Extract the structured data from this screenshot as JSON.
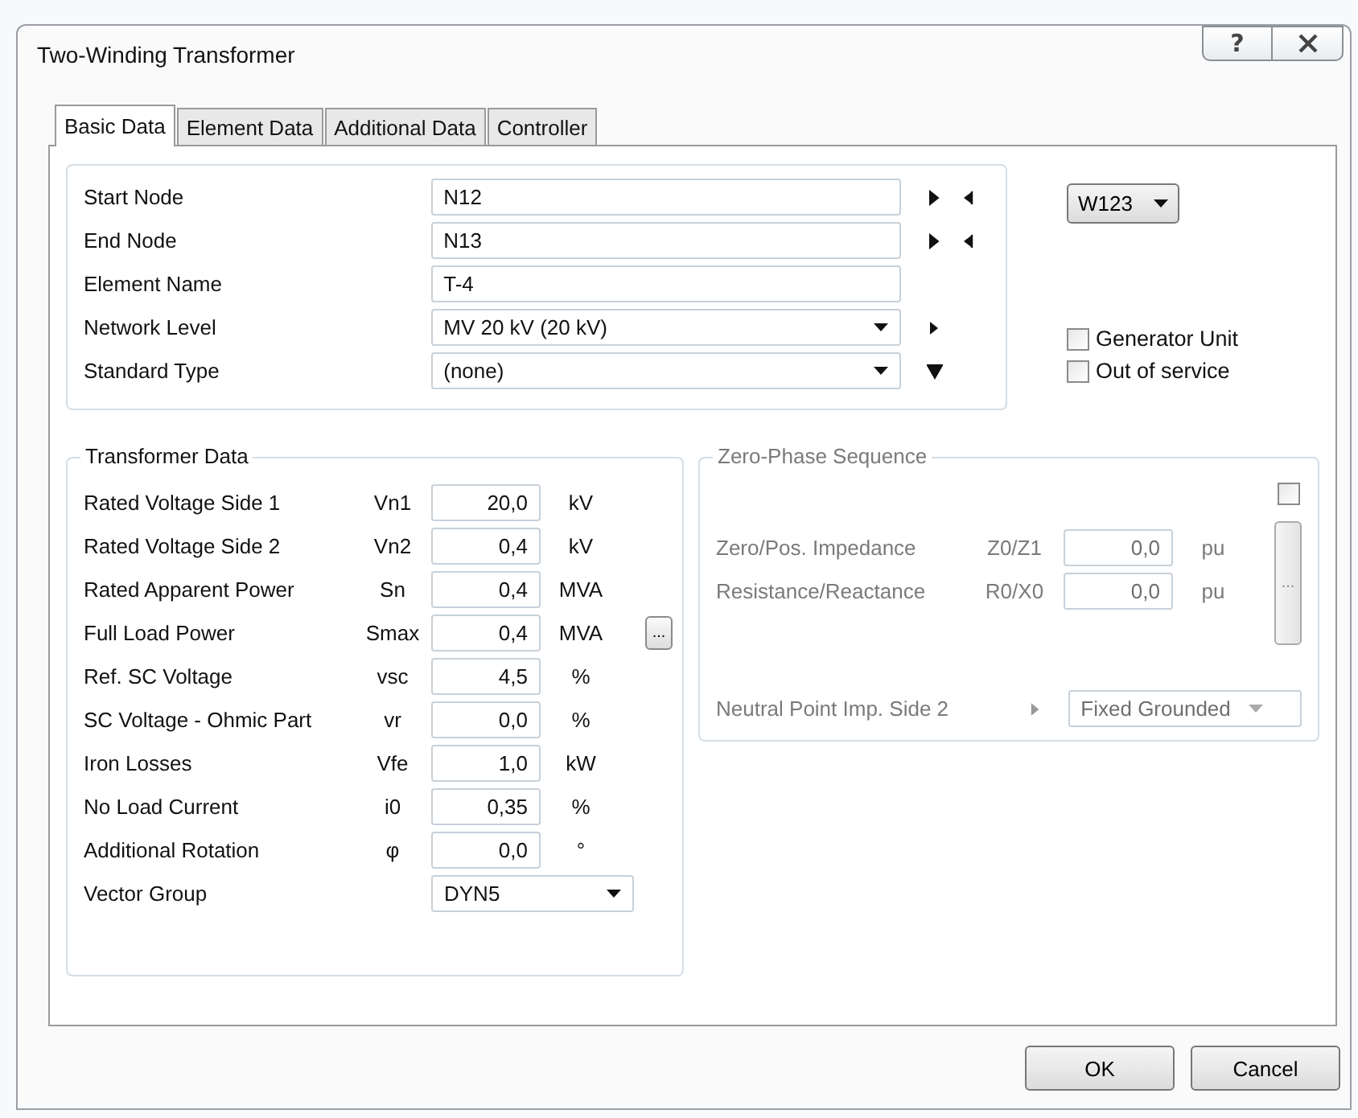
{
  "window": {
    "title": "Two-Winding Transformer",
    "help": "?"
  },
  "tabs": [
    {
      "label": "Basic Data",
      "selected": true
    },
    {
      "label": "Element Data",
      "selected": false
    },
    {
      "label": "Additional Data",
      "selected": false
    },
    {
      "label": "Controller",
      "selected": false
    }
  ],
  "general": [
    {
      "label": "Start Node",
      "kind": "node",
      "value": "N12"
    },
    {
      "label": "End Node",
      "kind": "node",
      "value": "N13"
    },
    {
      "label": "Element Name",
      "kind": "text",
      "value": "T-4"
    },
    {
      "label": "Network Level",
      "kind": "level",
      "value": "MV 20 kV (20 kV)"
    },
    {
      "label": "Standard Type",
      "kind": "type",
      "value": "(none)"
    }
  ],
  "variant": {
    "value": "W123"
  },
  "options": [
    {
      "label": "Generator Unit",
      "checked": false
    },
    {
      "label": "Out of service",
      "checked": false
    }
  ],
  "transformer_data": {
    "title": "Transformer Data",
    "rows": [
      {
        "label": "Rated Voltage Side 1",
        "symbol": "Vn1",
        "value": "20,0",
        "unit": "kV"
      },
      {
        "label": "Rated Voltage Side 2",
        "symbol": "Vn2",
        "value": "0,4",
        "unit": "kV"
      },
      {
        "label": "Rated Apparent Power",
        "symbol": "Sn",
        "value": "0,4",
        "unit": "MVA"
      },
      {
        "label": "Full Load Power",
        "symbol": "Smax",
        "value": "0,4",
        "unit": "MVA",
        "more": "..."
      },
      {
        "label": "Ref. SC Voltage",
        "symbol": "vsc",
        "value": "4,5",
        "unit": "%"
      },
      {
        "label": "SC Voltage - Ohmic Part",
        "symbol": "vr",
        "value": "0,0",
        "unit": "%"
      },
      {
        "label": "Iron Losses",
        "symbol": "Vfe",
        "value": "1,0",
        "unit": "kW"
      },
      {
        "label": "No Load Current",
        "symbol": "i0",
        "value": "0,35",
        "unit": "%"
      },
      {
        "label": "Additional Rotation",
        "symbol": "φ",
        "value": "0,0",
        "unit": "°"
      }
    ],
    "vector_group": {
      "label": "Vector Group",
      "value": "DYN5"
    }
  },
  "zero_phase": {
    "title": "Zero-Phase Sequence",
    "enabled": false,
    "checked": false,
    "more": "...",
    "rows": [
      {
        "label": "Zero/Pos. Impedance",
        "symbol": "Z0/Z1",
        "value": "0,0",
        "unit": "pu"
      },
      {
        "label": "Resistance/Reactance",
        "symbol": "R0/X0",
        "value": "0,0",
        "unit": "pu"
      }
    ],
    "neutral": {
      "label": "Neutral Point Imp. Side 2",
      "value": "Fixed Grounded"
    }
  },
  "buttons": [
    "OK",
    "Cancel"
  ]
}
